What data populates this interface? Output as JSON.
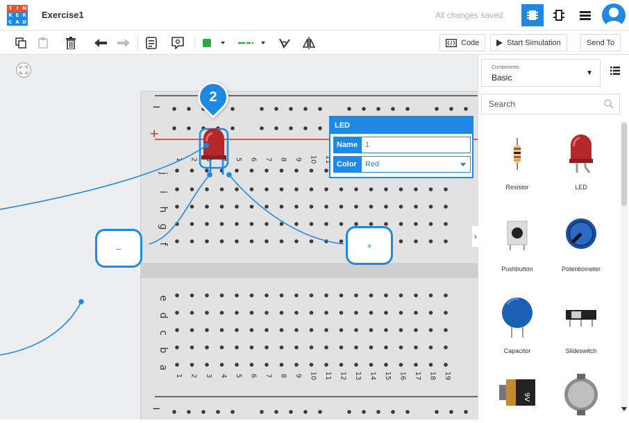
{
  "app": {
    "logo_letters": [
      "T",
      "I",
      "N",
      "K",
      "E",
      "R",
      "C",
      "A",
      "D"
    ],
    "logo_colors": [
      "#e8542c",
      "#e8542c",
      "#e8542c",
      "#1e88e5",
      "#1e88e5",
      "#1e88e5",
      "#1e88e5",
      "#1e88e5",
      "#1e88e5"
    ],
    "title": "Exercise1",
    "save_status": "All changes saved",
    "accent": "#1e88e5"
  },
  "header_views": [
    {
      "name": "circuit-view-icon",
      "active": true
    },
    {
      "name": "component-view-icon",
      "active": false
    },
    {
      "name": "schematic-list-icon",
      "active": false
    }
  ],
  "toolbar": {
    "icons": [
      "copy-icon",
      "paste-icon",
      "delete-icon",
      "undo-icon",
      "redo-icon",
      "note-icon",
      "notes-toggle-icon",
      "color-swatch-icon",
      "wire-style-icon",
      "rotate-icon",
      "flip-icon"
    ],
    "wire_color": "#2eaa44",
    "code_label": "Code",
    "start_simulation_label": "Start Simulation",
    "send_to_label": "Send To"
  },
  "inspector": {
    "title": "LED",
    "name_label": "Name",
    "name_value": "1",
    "color_label": "Color",
    "color_value": "Red"
  },
  "panel": {
    "components_label": "Components",
    "category": "Basic",
    "search_placeholder": "Search",
    "components": [
      "Resistor",
      "LED",
      "Pushbutton",
      "Potentiometer",
      "Capacitor",
      "Slideswitch"
    ],
    "battery_label": "9V"
  },
  "breadboard": {
    "column_numbers": [
      "1",
      "2",
      "3",
      "4",
      "5",
      "6",
      "7",
      "8",
      "9",
      "10",
      "11",
      "12",
      "13",
      "14",
      "15",
      "16",
      "17",
      "18",
      "19"
    ],
    "upper_rows": [
      "j",
      "i",
      "h",
      "g",
      "f"
    ],
    "lower_rows": [
      "e",
      "d",
      "c",
      "b",
      "a"
    ],
    "rail_minus": "−",
    "rail_plus": "+"
  },
  "callouts": {
    "step_number": "2",
    "minus_label": "–",
    "plus_label": "+"
  }
}
